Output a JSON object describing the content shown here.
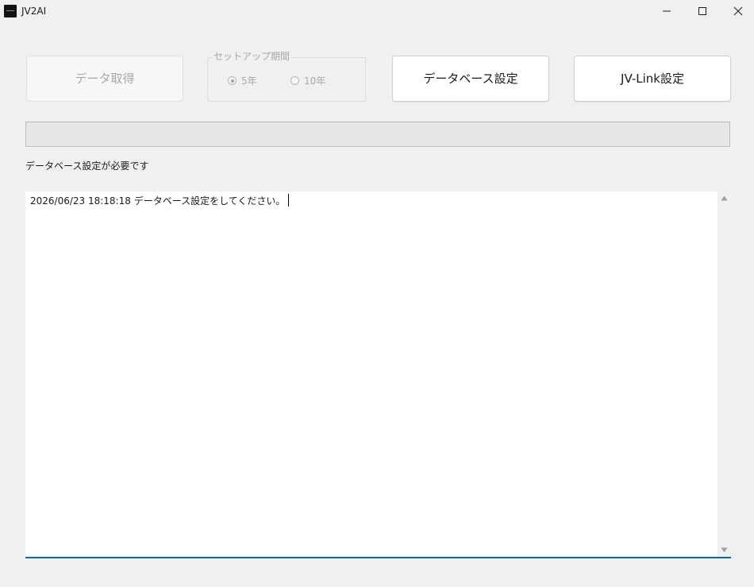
{
  "window": {
    "title": "JV2AI",
    "icon": "app-logo-icon",
    "controls": [
      "minimize-icon",
      "maximize-icon",
      "close-icon"
    ]
  },
  "toolbar": {
    "fetch_label": "データ取得",
    "fetch_enabled": false,
    "setup_period": {
      "legend": "セットアップ期間",
      "enabled": false,
      "options": [
        {
          "label": "5年",
          "selected": true
        },
        {
          "label": "10年",
          "selected": false
        }
      ]
    },
    "db_settings_label": "データベース設定",
    "jvlink_settings_label": "JV-Link設定"
  },
  "progress": {
    "value_percent": 0
  },
  "status": {
    "message": "データベース設定が必要です"
  },
  "log": {
    "lines": [
      "2026/06/23 18:18:18 データベース設定をしてください。"
    ]
  },
  "colors": {
    "window_bg": "#f0f0f0",
    "accent": "#0067c0",
    "disabled_text": "#a8a8a8"
  }
}
